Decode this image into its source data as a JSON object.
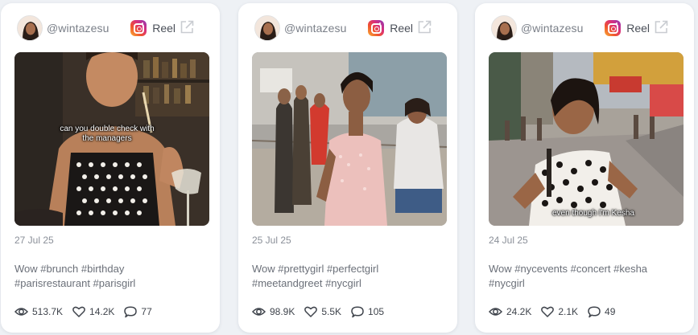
{
  "colors": {
    "background": "#eef1f5",
    "card": "#ffffff",
    "text_muted": "#8a8f98",
    "text_dark": "#3f444c"
  },
  "posts": [
    {
      "username": "@wintazesu",
      "platform_label": "Reel",
      "date": "27 Jul 25",
      "caption_line1": "Wow #brunch #birthday",
      "caption_line2": "#parisrestaurant #parisgirl",
      "overlay_text_line1": "can you double check with",
      "overlay_text_line2": "the managers",
      "views": "513.7K",
      "likes": "14.2K",
      "comments": "77"
    },
    {
      "username": "@wintazesu",
      "platform_label": "Reel",
      "date": "25 Jul 25",
      "caption_line1": "Wow #prettygirl #perfectgirl",
      "caption_line2": "#meetandgreet #nycgirl",
      "overlay_text_line1": "",
      "overlay_text_line2": "",
      "views": "98.9K",
      "likes": "5.5K",
      "comments": "105"
    },
    {
      "username": "@wintazesu",
      "platform_label": "Reel",
      "date": "24 Jul 25",
      "caption_line1": "Wow #nycevents #concert #kesha",
      "caption_line2": "#nycgirl",
      "overlay_text_line1": "even though I'm Kesha",
      "overlay_text_line2": "",
      "views": "24.2K",
      "likes": "2.1K",
      "comments": "49"
    }
  ],
  "icons": {
    "platform": "instagram-icon",
    "open": "external-link-icon",
    "views": "eye-icon",
    "likes": "heart-icon",
    "comments": "comment-icon"
  }
}
